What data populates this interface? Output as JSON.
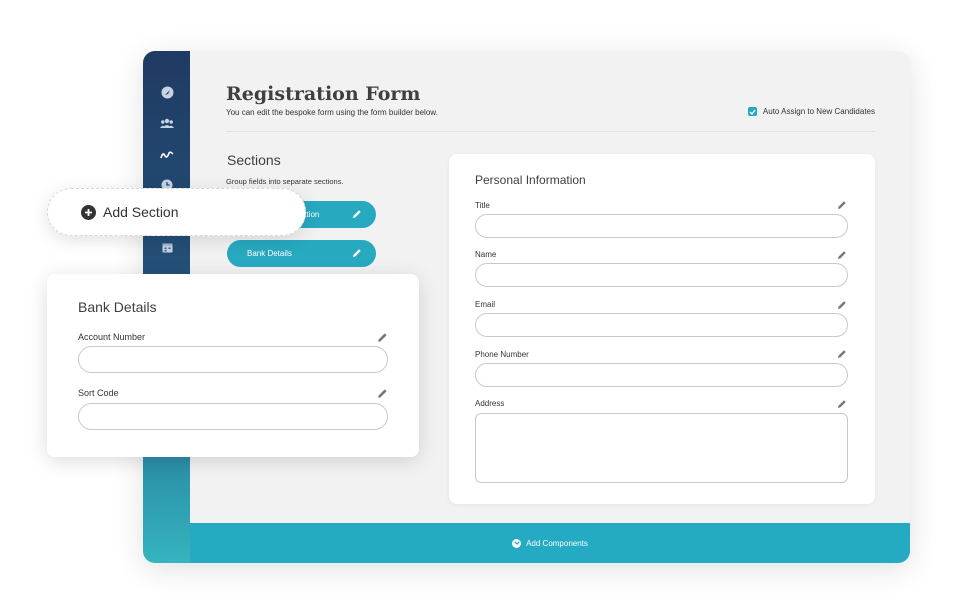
{
  "page": {
    "title": "Registration Form",
    "subtitle": "You can edit the bespoke form using the form builder below.",
    "auto_assign_label": "Auto Assign to New Candidates",
    "auto_assign_checked": true
  },
  "sidebar": {
    "icons": [
      "dashboard-icon",
      "users-icon",
      "signature-icon",
      "clock-icon",
      "calendar-icon"
    ]
  },
  "sections": {
    "title": "Sections",
    "description": "Group fields into separate sections.",
    "items": [
      {
        "label": "Personal Information",
        "visible_label": "ation"
      },
      {
        "label": "Bank Details"
      }
    ]
  },
  "personal_card": {
    "title": "Personal Information",
    "fields": [
      {
        "label": "Title"
      },
      {
        "label": "Name"
      },
      {
        "label": "Email"
      },
      {
        "label": "Phone Number"
      },
      {
        "label": "Address"
      }
    ]
  },
  "footer": {
    "add_components_label": "Add Components"
  },
  "add_section": {
    "label": "Add Section"
  },
  "bank_card": {
    "title": "Bank Details",
    "fields": [
      {
        "label": "Account Number"
      },
      {
        "label": "Sort Code"
      }
    ]
  },
  "colors": {
    "accent": "#27a9c0",
    "sidebar_top": "#1f3a63",
    "sidebar_bottom": "#35b4bf",
    "text": "#3f3f3f"
  }
}
